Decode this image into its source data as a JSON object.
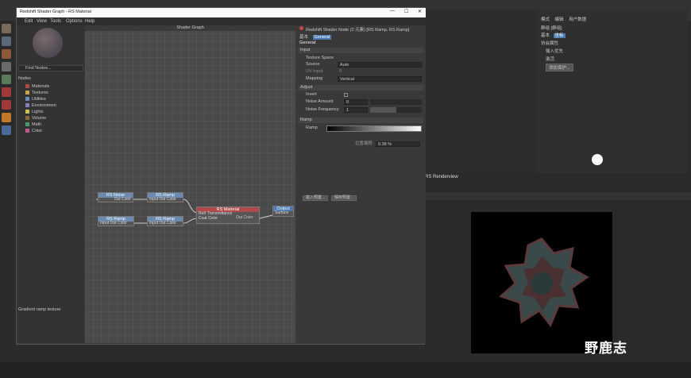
{
  "window": {
    "title": "Redshift Shader Graph - RS Material",
    "menu": [
      "Edit",
      "View",
      "Tools",
      "Options",
      "Help"
    ],
    "controls": [
      "—",
      "☐",
      "✕"
    ]
  },
  "node_browser": {
    "search_placeholder": "Find Nodes...",
    "header": "Nodes",
    "categories": [
      {
        "label": "Materials",
        "color": "#b04a4a"
      },
      {
        "label": "Textures",
        "color": "#c8a24a"
      },
      {
        "label": "Utilities",
        "color": "#6a8ac0"
      },
      {
        "label": "Environment",
        "color": "#8a7ac0"
      },
      {
        "label": "Lights",
        "color": "#c8c04a"
      },
      {
        "label": "Volume",
        "color": "#8a6a3a"
      },
      {
        "label": "Math",
        "color": "#4a9a6a"
      },
      {
        "label": "Color",
        "color": "#c05a8a"
      }
    ],
    "description": "Gradient ramp texture"
  },
  "graph": {
    "title": "Shader Graph",
    "nodes": {
      "rs_noise": {
        "title": "RS Noise",
        "port": "Out Color"
      },
      "rs_ramp1": {
        "title": "RS Ramp",
        "port": "Input Out Color"
      },
      "rs_ramp2": {
        "title": "RS Ramp",
        "port": "Input Out Color"
      },
      "rs_ramp3": {
        "title": "RS Ramp",
        "port": "Input Out Color"
      },
      "rs_material": {
        "title": "RS Material",
        "ports": [
          "Refr Transmittance",
          "Coat Color"
        ],
        "out": "Out Color"
      },
      "output": {
        "title": "Output",
        "port": "Surface"
      }
    }
  },
  "properties": {
    "header": "Redshift Shader Node (2 元素) [RS Ramp, RS Ramp]",
    "tabs": [
      "基本",
      "General"
    ],
    "general_label": "General",
    "input_section": "Input",
    "texture_space": "Texture Space",
    "source_label": "Source",
    "source_value": "Auto",
    "uv_input_label": "UV Input",
    "uv_input_value": "0",
    "mapping_label": "Mapping",
    "mapping_value": "Vertical",
    "adjust_section": "Adjust",
    "invert_label": "Invert",
    "noise_amount_label": "Noise Amount",
    "noise_amount_value": "0",
    "noise_freq_label": "Noise Frequency",
    "noise_freq_value": "1",
    "ramp_section": "Ramp",
    "ramp_label": "Ramp",
    "pos_label": "位置偏移",
    "pos_value": "9.38 %",
    "load_button": "载入预置...",
    "save_button": "保存预置..."
  },
  "right_panels": {
    "attr_tabs": [
      "模式",
      "编辑",
      "用户数据"
    ],
    "attr_title": "群组 [群组]",
    "attr_sub_tabs": [
      "基本",
      "坐标"
    ],
    "attr_section": "协会属性",
    "attr_rows": [
      "输入优先",
      "激活"
    ],
    "attr_button": "添加保护..."
  },
  "viewport": {
    "label": "RS Renderview"
  },
  "watermark": "野鹿志"
}
